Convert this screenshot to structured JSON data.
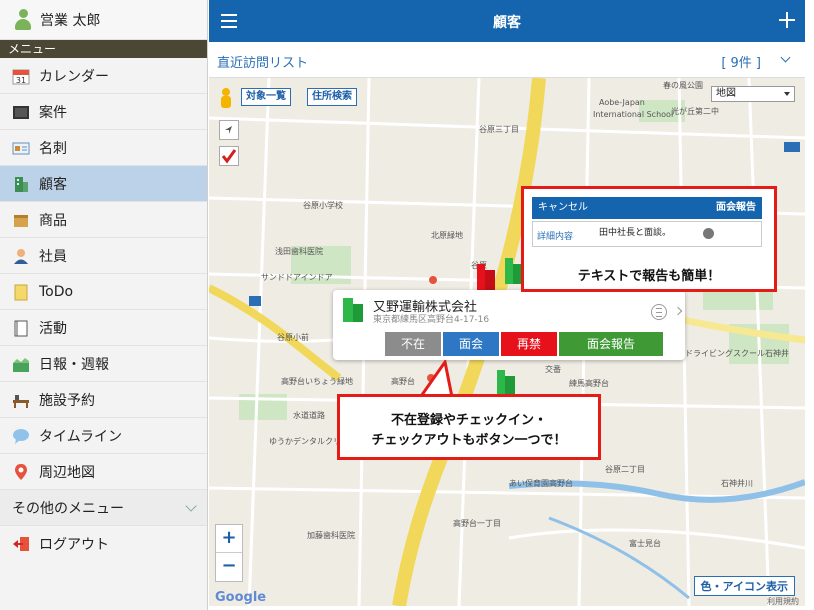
{
  "sidebar": {
    "user_name": "営業 太郎",
    "menu_header": "メニュー",
    "items": [
      {
        "label": "カレンダー",
        "icon": "calendar-icon"
      },
      {
        "label": "案件",
        "icon": "briefcase-icon"
      },
      {
        "label": "名刺",
        "icon": "business-card-icon"
      },
      {
        "label": "顧客",
        "icon": "building-icon",
        "active": true
      },
      {
        "label": "商品",
        "icon": "package-icon"
      },
      {
        "label": "社員",
        "icon": "person-icon"
      },
      {
        "label": "ToDo",
        "icon": "note-icon"
      },
      {
        "label": "活動",
        "icon": "notebook-icon"
      },
      {
        "label": "日報・週報",
        "icon": "report-icon"
      },
      {
        "label": "施設予約",
        "icon": "facility-icon"
      },
      {
        "label": "タイムライン",
        "icon": "speech-bubble-icon"
      },
      {
        "label": "周辺地図",
        "icon": "map-pin-icon"
      }
    ],
    "other_menu": "その他のメニュー",
    "logout": "ログアウト"
  },
  "header": {
    "title": "顧客"
  },
  "subheader": {
    "list_title": "直近訪問リスト",
    "count": "[ 9件 ]"
  },
  "map": {
    "btn_all": "対象一覧",
    "btn_address": "住所検索",
    "map_type": "地図",
    "google": "Google",
    "legend_btn": "色・アイコン表示",
    "copyright": "利用規約",
    "zoom_in": "+",
    "zoom_out": "−",
    "popup": {
      "name": "又野運輸株式会社",
      "address": "東京都練馬区高野台4-17-16",
      "buttons": {
        "absent": "不在",
        "meeting": "面会",
        "forbidden": "再禁",
        "report": "面会報告"
      }
    },
    "report_card": {
      "cancel": "キャンセル",
      "report": "面会報告",
      "detail_label": "詳細内容",
      "detail_text": "田中社長と面談。"
    },
    "callout_report": "テキストで報告も簡単！",
    "callout_buttons_line1": "不在登録やチェックイン・",
    "callout_buttons_line2": "チェックアウトもボタン一つで！",
    "labels": [
      "Aobe-Japan",
      "International School",
      "光が丘第二中",
      "谷原三丁目",
      "谷原小学校",
      "北原緑地",
      "浅田歯科医院",
      "谷原",
      "サンドドアインドア",
      "谷原小前",
      "高野台いちょう緑地",
      "高野台",
      "水道道路",
      "交番",
      "石神井川",
      "高野台一丁目",
      "加藤歯科医院",
      "富士見台",
      "ゆうかデンタルクリニック",
      "あい保育園高野台",
      "ドライビングスクール石神井",
      "谷原二丁目",
      "練馬高野台",
      "春の風公園"
    ],
    "colors": {
      "accent": "#1565ae",
      "absent": "#8c8c8c",
      "meeting": "#2d77c4",
      "forbidden": "#e7111c",
      "report": "#3f9a36",
      "callout": "#e41b17"
    }
  }
}
